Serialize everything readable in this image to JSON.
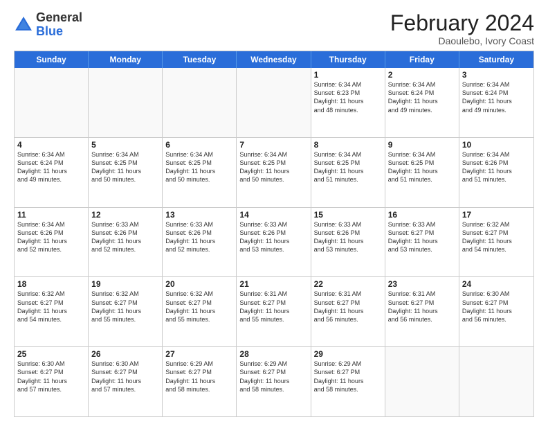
{
  "logo": {
    "general": "General",
    "blue": "Blue"
  },
  "header": {
    "month": "February 2024",
    "location": "Daoulebo, Ivory Coast"
  },
  "weekdays": [
    "Sunday",
    "Monday",
    "Tuesday",
    "Wednesday",
    "Thursday",
    "Friday",
    "Saturday"
  ],
  "weeks": [
    [
      {
        "day": "",
        "detail": ""
      },
      {
        "day": "",
        "detail": ""
      },
      {
        "day": "",
        "detail": ""
      },
      {
        "day": "",
        "detail": ""
      },
      {
        "day": "1",
        "detail": "Sunrise: 6:34 AM\nSunset: 6:23 PM\nDaylight: 11 hours\nand 48 minutes."
      },
      {
        "day": "2",
        "detail": "Sunrise: 6:34 AM\nSunset: 6:24 PM\nDaylight: 11 hours\nand 49 minutes."
      },
      {
        "day": "3",
        "detail": "Sunrise: 6:34 AM\nSunset: 6:24 PM\nDaylight: 11 hours\nand 49 minutes."
      }
    ],
    [
      {
        "day": "4",
        "detail": "Sunrise: 6:34 AM\nSunset: 6:24 PM\nDaylight: 11 hours\nand 49 minutes."
      },
      {
        "day": "5",
        "detail": "Sunrise: 6:34 AM\nSunset: 6:25 PM\nDaylight: 11 hours\nand 50 minutes."
      },
      {
        "day": "6",
        "detail": "Sunrise: 6:34 AM\nSunset: 6:25 PM\nDaylight: 11 hours\nand 50 minutes."
      },
      {
        "day": "7",
        "detail": "Sunrise: 6:34 AM\nSunset: 6:25 PM\nDaylight: 11 hours\nand 50 minutes."
      },
      {
        "day": "8",
        "detail": "Sunrise: 6:34 AM\nSunset: 6:25 PM\nDaylight: 11 hours\nand 51 minutes."
      },
      {
        "day": "9",
        "detail": "Sunrise: 6:34 AM\nSunset: 6:25 PM\nDaylight: 11 hours\nand 51 minutes."
      },
      {
        "day": "10",
        "detail": "Sunrise: 6:34 AM\nSunset: 6:26 PM\nDaylight: 11 hours\nand 51 minutes."
      }
    ],
    [
      {
        "day": "11",
        "detail": "Sunrise: 6:34 AM\nSunset: 6:26 PM\nDaylight: 11 hours\nand 52 minutes."
      },
      {
        "day": "12",
        "detail": "Sunrise: 6:33 AM\nSunset: 6:26 PM\nDaylight: 11 hours\nand 52 minutes."
      },
      {
        "day": "13",
        "detail": "Sunrise: 6:33 AM\nSunset: 6:26 PM\nDaylight: 11 hours\nand 52 minutes."
      },
      {
        "day": "14",
        "detail": "Sunrise: 6:33 AM\nSunset: 6:26 PM\nDaylight: 11 hours\nand 53 minutes."
      },
      {
        "day": "15",
        "detail": "Sunrise: 6:33 AM\nSunset: 6:26 PM\nDaylight: 11 hours\nand 53 minutes."
      },
      {
        "day": "16",
        "detail": "Sunrise: 6:33 AM\nSunset: 6:27 PM\nDaylight: 11 hours\nand 53 minutes."
      },
      {
        "day": "17",
        "detail": "Sunrise: 6:32 AM\nSunset: 6:27 PM\nDaylight: 11 hours\nand 54 minutes."
      }
    ],
    [
      {
        "day": "18",
        "detail": "Sunrise: 6:32 AM\nSunset: 6:27 PM\nDaylight: 11 hours\nand 54 minutes."
      },
      {
        "day": "19",
        "detail": "Sunrise: 6:32 AM\nSunset: 6:27 PM\nDaylight: 11 hours\nand 55 minutes."
      },
      {
        "day": "20",
        "detail": "Sunrise: 6:32 AM\nSunset: 6:27 PM\nDaylight: 11 hours\nand 55 minutes."
      },
      {
        "day": "21",
        "detail": "Sunrise: 6:31 AM\nSunset: 6:27 PM\nDaylight: 11 hours\nand 55 minutes."
      },
      {
        "day": "22",
        "detail": "Sunrise: 6:31 AM\nSunset: 6:27 PM\nDaylight: 11 hours\nand 56 minutes."
      },
      {
        "day": "23",
        "detail": "Sunrise: 6:31 AM\nSunset: 6:27 PM\nDaylight: 11 hours\nand 56 minutes."
      },
      {
        "day": "24",
        "detail": "Sunrise: 6:30 AM\nSunset: 6:27 PM\nDaylight: 11 hours\nand 56 minutes."
      }
    ],
    [
      {
        "day": "25",
        "detail": "Sunrise: 6:30 AM\nSunset: 6:27 PM\nDaylight: 11 hours\nand 57 minutes."
      },
      {
        "day": "26",
        "detail": "Sunrise: 6:30 AM\nSunset: 6:27 PM\nDaylight: 11 hours\nand 57 minutes."
      },
      {
        "day": "27",
        "detail": "Sunrise: 6:29 AM\nSunset: 6:27 PM\nDaylight: 11 hours\nand 58 minutes."
      },
      {
        "day": "28",
        "detail": "Sunrise: 6:29 AM\nSunset: 6:27 PM\nDaylight: 11 hours\nand 58 minutes."
      },
      {
        "day": "29",
        "detail": "Sunrise: 6:29 AM\nSunset: 6:27 PM\nDaylight: 11 hours\nand 58 minutes."
      },
      {
        "day": "",
        "detail": ""
      },
      {
        "day": "",
        "detail": ""
      }
    ]
  ]
}
